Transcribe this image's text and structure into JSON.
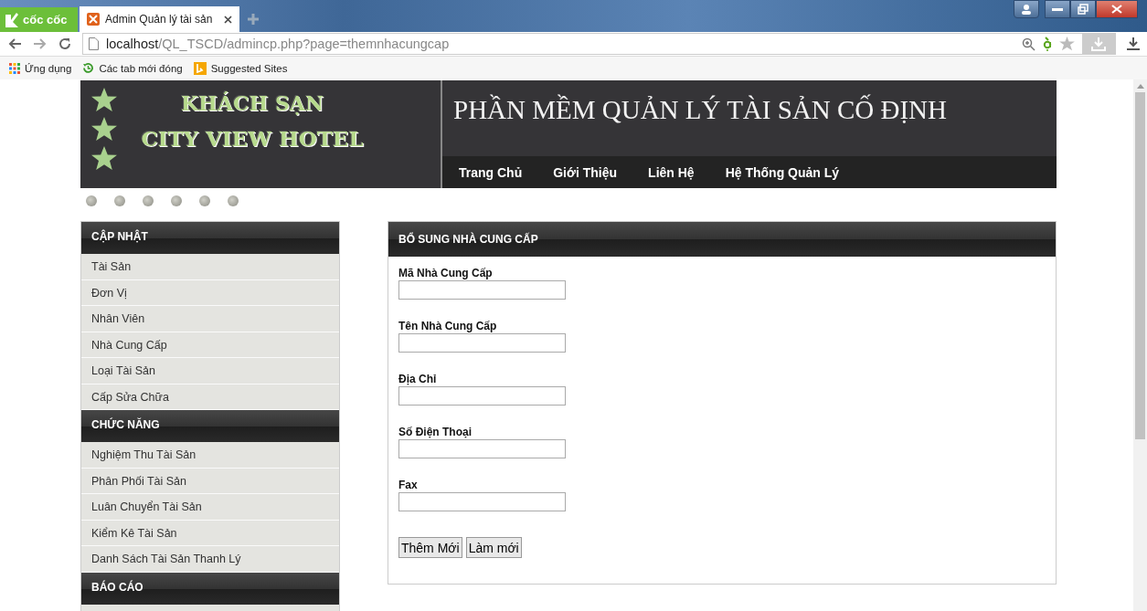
{
  "browser": {
    "brand": "cốc cốc",
    "tab_title": "Admin Quản lý tài sản",
    "url_host": "localhost",
    "url_path": "/QL_TSCD/admincp.php?page=themnhacungcap",
    "bookmarks": [
      {
        "label": "Ứng dụng",
        "kind": "apps"
      },
      {
        "label": "Các tab mới đóng",
        "kind": "history"
      },
      {
        "label": "Suggested Sites",
        "kind": "bing"
      }
    ]
  },
  "header": {
    "logo_line_1": "KHÁCH SẠN",
    "logo_line_2": "CITY VIEW HOTEL",
    "title": "PHẦN MỀM QUẢN LÝ TÀI SẢN CỐ ĐỊNH",
    "nav": [
      "Trang Chủ",
      "Giới Thiệu",
      "Liên Hệ",
      "Hệ Thống Quản Lý"
    ]
  },
  "sidebar": {
    "sections": [
      {
        "title": "CẬP NHẬT",
        "items": [
          "Tài Sản",
          "Đơn Vị",
          "Nhân Viên",
          "Nhà Cung Cấp",
          "Loại Tài Sản",
          "Cấp Sửa Chữa"
        ]
      },
      {
        "title": "CHỨC NĂNG",
        "items": [
          "Nghiệm Thu Tài Sản",
          "Phân Phối Tài Sản",
          "Luân Chuyển Tài Sản",
          "Kiểm Kê Tài Sản",
          "Danh Sách Tài Sản Thanh Lý"
        ]
      },
      {
        "title": "BÁO CÁO"
      }
    ]
  },
  "form": {
    "title": "BỔ SUNG NHÀ CUNG CẤP",
    "fields": [
      "Mã Nhà Cung Cấp",
      "Tên Nhà Cung Cấp",
      "Địa Chỉ",
      "Số Điện Thoại",
      "Fax"
    ],
    "buttons": [
      "Thêm Mới",
      "Làm mới"
    ]
  }
}
